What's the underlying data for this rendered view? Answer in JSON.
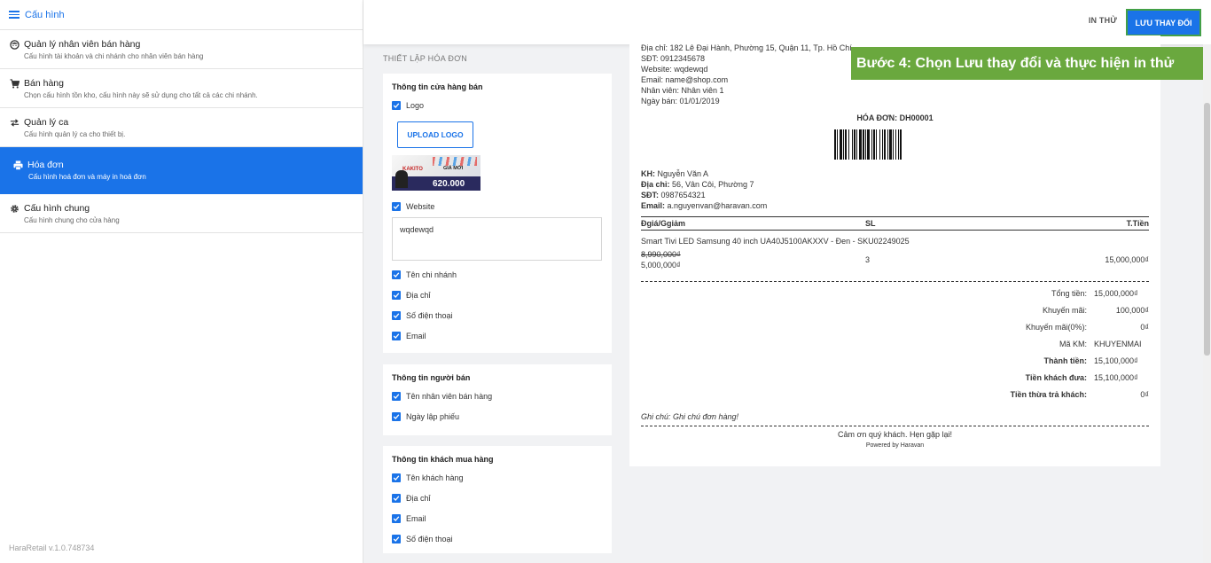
{
  "sidebar": {
    "header": "Cấu hình",
    "items": [
      {
        "title": "Quản lý nhân viên bán hàng",
        "desc": "Cấu hình tài khoản và chi nhánh cho nhân viên bán hàng",
        "icon": "face-icon"
      },
      {
        "title": "Bán hàng",
        "desc": "Chọn cấu hình tồn kho, cấu hình này sẽ sử dụng cho tất cả các chi nhánh.",
        "icon": "cart-icon"
      },
      {
        "title": "Quản lý ca",
        "desc": "Cấu hình quản lý ca cho thiết bị.",
        "icon": "swap-icon"
      },
      {
        "title": "Hóa đơn",
        "desc": "Cấu hình hoá đơn và máy in hoá đơn",
        "icon": "printer-icon"
      },
      {
        "title": "Cấu hình chung",
        "desc": "Cấu hình chung cho cửa hàng",
        "icon": "gear-icon"
      }
    ],
    "version": "HaraRetail v.1.0.748734"
  },
  "topbar": {
    "test_print": "IN THỬ",
    "save": "LƯU THAY ĐỔI"
  },
  "settings": {
    "section_title": "THIẾT LẬP HÓA ĐƠN",
    "store": {
      "title": "Thông tin cửa hàng bán",
      "logo": "Logo",
      "upload": "UPLOAD LOGO",
      "logo_image": {
        "brand": "KAKITO",
        "tag": "GIÁ MỚI",
        "price": "620.000"
      },
      "website": "Website",
      "website_value": "wqdewqd",
      "branch": "Tên chi nhánh",
      "address": "Địa chỉ",
      "phone": "Số điện thoại",
      "email": "Email"
    },
    "seller": {
      "title": "Thông tin người bán",
      "staff": "Tên nhân viên bán hàng",
      "date": "Ngày lập phiếu"
    },
    "buyer": {
      "title": "Thông tin khách mua hàng",
      "name": "Tên khách hàng",
      "address": "Địa chỉ",
      "email": "Email",
      "phone": "Số điện thoại"
    }
  },
  "receipt": {
    "store_lines": [
      "Địa chỉ: 182 Lê Đại Hành, Phường 15, Quận 11, Tp. Hồ Chí",
      "SĐT: 0912345678",
      "Website: wqdewqd",
      "Email: name@shop.com",
      "Nhân viên: Nhân viên 1",
      "Ngày bán: 01/01/2019"
    ],
    "invoice_title": "HÓA ĐƠN: DH00001",
    "customer": {
      "name_label": "KH:",
      "name": "Nguyễn Văn A",
      "address_label": "Địa chỉ:",
      "address": "56, Vân Côi, Phường 7",
      "phone_label": "SĐT:",
      "phone": "0987654321",
      "email_label": "Email:",
      "email": "a.nguyenvan@haravan.com"
    },
    "columns": [
      "Đgiá/Ggiảm",
      "SL",
      "T.Tiền"
    ],
    "item": {
      "name": "Smart Tivi LED Samsung 40 inch UA40J5100AKXXV - Đen - SKU02249025",
      "old_price": "8,990,000₫",
      "price": "5,000,000₫",
      "qty": "3",
      "total": "15,000,000₫"
    },
    "totals": [
      {
        "label": "Tổng tiền:",
        "value": "15,000,000₫",
        "bold": false
      },
      {
        "label": "Khuyến mãi:",
        "value": "100,000₫",
        "bold": false
      },
      {
        "label": "Khuyến mãi(0%):",
        "value": "0₫",
        "bold": false
      },
      {
        "label": "Mã KM:",
        "value": "KHUYENMAI",
        "bold": false
      },
      {
        "label": "Thành tiền:",
        "value": "15,100,000₫",
        "bold": true
      },
      {
        "label": "Tiền khách đưa:",
        "value": "15,100,000₫",
        "bold": true
      },
      {
        "label": "Tiền thừa trả khách:",
        "value": "0₫",
        "bold": true
      }
    ],
    "note": "Ghi chú: Ghi chú đơn hàng!",
    "thanks": "Cảm ơn quý khách. Hẹn gặp lại!",
    "powered": "Powered by Haravan"
  },
  "banner": "Bước 4: Chọn Lưu thay đổi và thực hiện in thử",
  "colors": {
    "accent": "#1a73e8",
    "banner": "#6aa83e"
  }
}
